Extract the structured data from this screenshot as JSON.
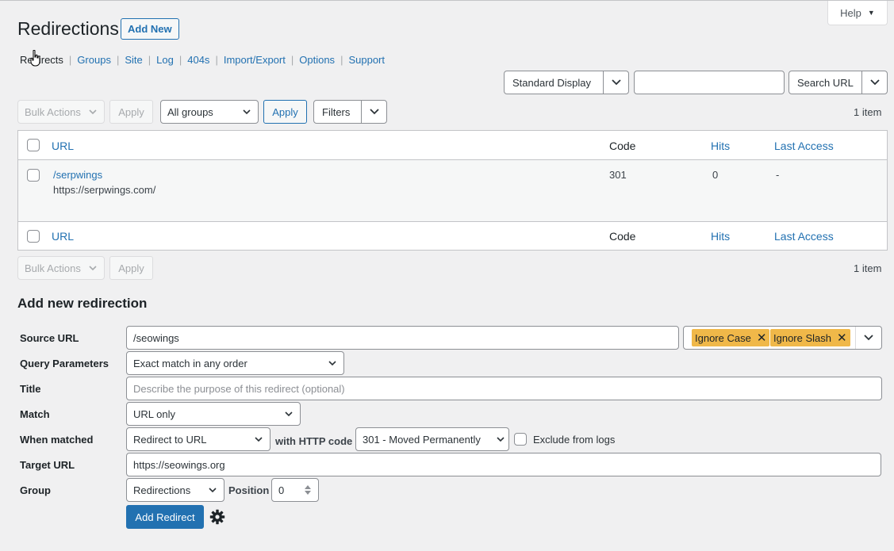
{
  "help": {
    "label": "Help"
  },
  "page": {
    "title": "Redirections",
    "add_new": "Add New"
  },
  "subnav": [
    {
      "label": "Redirects",
      "current": true
    },
    {
      "label": "Groups"
    },
    {
      "label": "Site"
    },
    {
      "label": "Log"
    },
    {
      "label": "404s"
    },
    {
      "label": "Import/Export"
    },
    {
      "label": "Options"
    },
    {
      "label": "Support"
    }
  ],
  "toolbar": {
    "display_select": "Standard Display",
    "search_placeholder": "",
    "search_button": "Search URL",
    "bulk_actions": "Bulk Actions",
    "apply": "Apply",
    "group_filter": "All groups",
    "apply_filter": "Apply",
    "filters": "Filters",
    "item_count": "1 item"
  },
  "table": {
    "columns": {
      "url": "URL",
      "code": "Code",
      "hits": "Hits",
      "last_access": "Last Access"
    },
    "rows": [
      {
        "source": "/serpwings",
        "target": "https://serpwings.com/",
        "code": "301",
        "hits": "0",
        "last_access": "-"
      }
    ]
  },
  "form": {
    "heading": "Add new redirection",
    "source_label": "Source URL",
    "source_value": "/seowings",
    "tags": [
      "Ignore Case",
      "Ignore Slash"
    ],
    "query_label": "Query Parameters",
    "query_value": "Exact match in any order",
    "title_label": "Title",
    "title_placeholder": "Describe the purpose of this redirect (optional)",
    "match_label": "Match",
    "match_value": "URL only",
    "when_label": "When matched",
    "when_value": "Redirect to URL",
    "http_code_label": "with HTTP code",
    "http_code_value": "301 - Moved Permanently",
    "exclude_label": "Exclude from logs",
    "target_label": "Target URL",
    "target_value": "https://seowings.org",
    "group_label": "Group",
    "group_value": "Redirections",
    "position_label": "Position",
    "position_value": "0",
    "submit": "Add Redirect"
  }
}
